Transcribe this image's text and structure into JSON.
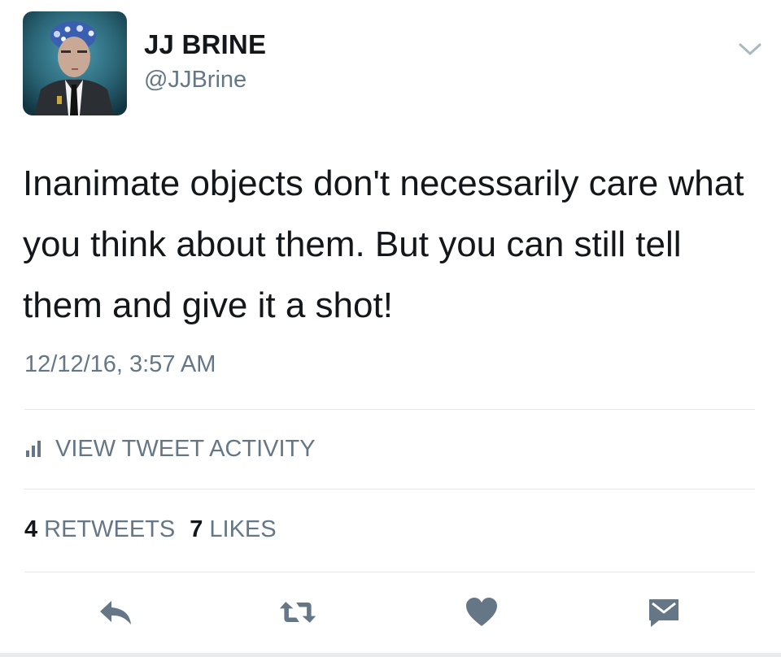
{
  "author": {
    "name": "JJ BRINE",
    "handle": "@JJBrine",
    "avatar_icon": "profile-photo"
  },
  "tweet": {
    "text": "Inanimate objects don't necessarily care what you think about them. But you can still tell them and give it a shot!",
    "timestamp": "12/12/16, 3:57 AM"
  },
  "activity": {
    "label": "VIEW TWEET ACTIVITY",
    "icon": "bar-chart-icon"
  },
  "stats": {
    "retweets_count": "4",
    "retweets_label": "RETWEETS",
    "likes_count": "7",
    "likes_label": "LIKES"
  },
  "actions": {
    "icons": [
      "reply-icon",
      "retweet-icon",
      "like-heart-icon",
      "direct-message-icon"
    ]
  },
  "colors": {
    "text_primary": "#14171a",
    "text_secondary": "#657786",
    "divider": "#e1e8ed",
    "icon_gray": "#657786"
  }
}
